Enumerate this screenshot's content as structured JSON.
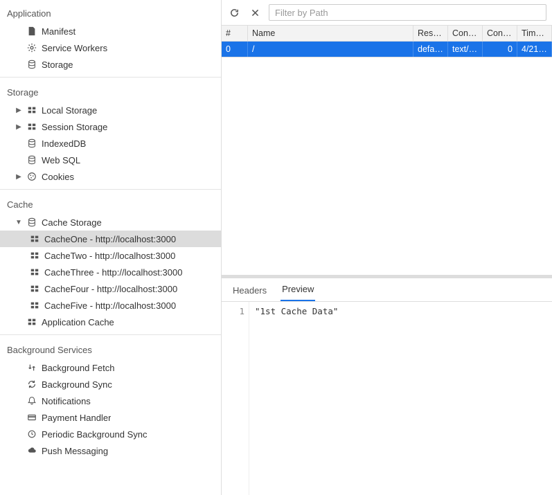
{
  "toolbar": {
    "filter_placeholder": "Filter by Path"
  },
  "sidebar": {
    "sections": {
      "application": {
        "title": "Application"
      },
      "storage": {
        "title": "Storage"
      },
      "cache": {
        "title": "Cache"
      },
      "bg": {
        "title": "Background Services"
      }
    },
    "application": {
      "manifest": "Manifest",
      "service_workers": "Service Workers",
      "storage": "Storage"
    },
    "storage": {
      "local_storage": "Local Storage",
      "session_storage": "Session Storage",
      "indexeddb": "IndexedDB",
      "web_sql": "Web SQL",
      "cookies": "Cookies"
    },
    "cache": {
      "cache_storage": "Cache Storage",
      "items": [
        "CacheOne - http://localhost:3000",
        "CacheTwo - http://localhost:3000",
        "CacheThree - http://localhost:3000",
        "CacheFour - http://localhost:3000",
        "CacheFive - http://localhost:3000"
      ],
      "application_cache": "Application Cache"
    },
    "bg": {
      "background_fetch": "Background Fetch",
      "background_sync": "Background Sync",
      "notifications": "Notifications",
      "payment_handler": "Payment Handler",
      "periodic_bg_sync": "Periodic Background Sync",
      "push_messaging": "Push Messaging"
    }
  },
  "table": {
    "headers": {
      "idx": "#",
      "name": "Name",
      "resp": "Resp…",
      "ct": "Cont…",
      "cl": "Cont…",
      "time": "Tim…"
    },
    "rows": [
      {
        "idx": "0",
        "name": "/",
        "resp": "defa…",
        "ct": "text/…",
        "cl": "0",
        "time": "4/21…"
      }
    ]
  },
  "lower": {
    "tabs": {
      "headers": "Headers",
      "preview": "Preview"
    },
    "gutter_line": "1",
    "preview_text": "\"1st Cache Data\""
  }
}
